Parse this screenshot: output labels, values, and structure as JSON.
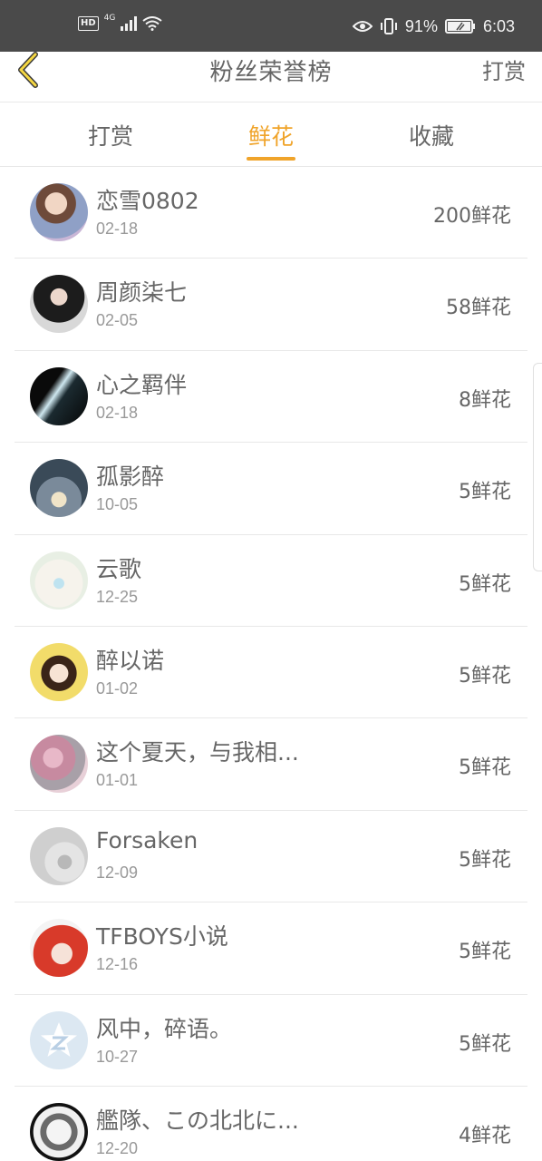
{
  "status_bar": {
    "hd": "HD",
    "network": "4G",
    "battery_percent": "91%",
    "time": "6:03"
  },
  "header": {
    "title": "粉丝荣誉榜",
    "action": "打赏",
    "back_icon": "chevron-left-icon",
    "accent_color": "#f5d742"
  },
  "tabs": [
    {
      "label": "打赏",
      "active": false
    },
    {
      "label": "鲜花",
      "active": true
    },
    {
      "label": "收藏",
      "active": false
    }
  ],
  "active_color": "#f0a42a",
  "fans": [
    {
      "name": "恋雪0802",
      "date": "02-18",
      "count": "200鲜花"
    },
    {
      "name": "周颜柒七",
      "date": "02-05",
      "count": "58鲜花"
    },
    {
      "name": "心之羁伴",
      "date": "02-18",
      "count": "8鲜花"
    },
    {
      "name": "孤影醉",
      "date": "10-05",
      "count": "5鲜花"
    },
    {
      "name": "云歌",
      "date": "12-25",
      "count": "5鲜花"
    },
    {
      "name": "醉以诺",
      "date": "01-02",
      "count": "5鲜花"
    },
    {
      "name": "这个夏天，与我相...",
      "date": "01-01",
      "count": "5鲜花"
    },
    {
      "name": "Forsaken",
      "date": "12-09",
      "count": "5鲜花"
    },
    {
      "name": "TFBOYS小说",
      "date": "12-16",
      "count": "5鲜花"
    },
    {
      "name": "风中，碎语。",
      "date": "10-27",
      "count": "5鲜花"
    },
    {
      "name": "艦隊、この北北に...",
      "date": "12-20",
      "count": "4鲜花"
    }
  ]
}
